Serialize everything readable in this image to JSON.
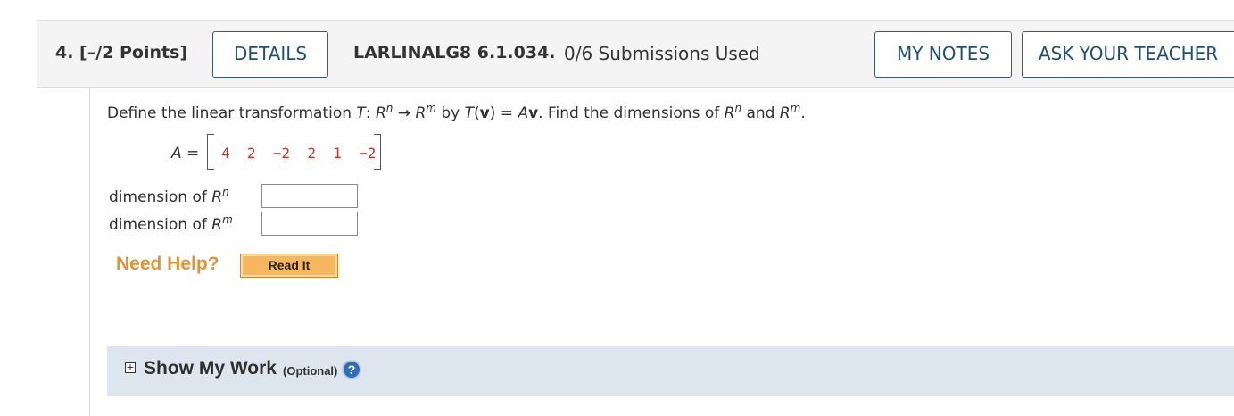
{
  "question": {
    "number_points": "4.  [–/2 Points]",
    "details_label": "DETAILS",
    "code": "LARLINALG8 6.1.034.",
    "submissions": "0/6 Submissions Used",
    "my_notes_label": "MY NOTES",
    "ask_teacher_label": "ASK YOUR TEACHER"
  },
  "problem": {
    "text_1": "Define the linear transformation ",
    "T": "T",
    "colon": ": ",
    "R": "R",
    "n": "n",
    "m": "m",
    "arrow": " → ",
    "by": " by ",
    "Tv_open": "T",
    "v_paren": "(",
    "v": "v",
    "v_close": ") = ",
    "A": "A",
    "text_2": ". Find the dimensions of ",
    "and": " and ",
    "period": "."
  },
  "matrix": {
    "label": "A =",
    "row": "4  2  −2  2  1  −2"
  },
  "answers": {
    "dim_n_label": "dimension of ",
    "dim_m_label": "dimension of ",
    "dim_n_value": "",
    "dim_m_value": ""
  },
  "help": {
    "need_help": "Need Help?",
    "read_it": "Read It"
  },
  "show_my_work": {
    "expand_symbol": "+",
    "label": "Show My Work",
    "optional": "(Optional)",
    "help_symbol": "?"
  },
  "colors": {
    "button_text": "#1f4e79",
    "need_help": "#e8922c",
    "read_it_bg": "#f7b75e",
    "matrix_text": "#c0392b",
    "smw_bg": "#dde6ee"
  }
}
